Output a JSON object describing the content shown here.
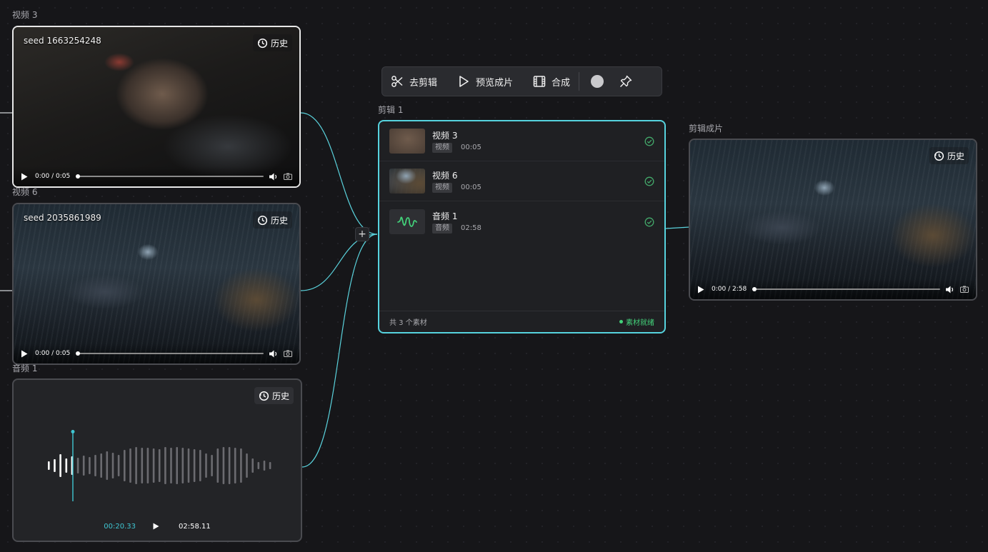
{
  "nodes": {
    "video3": {
      "label": "视频 3",
      "seed": "seed 1663254248",
      "history": "历史",
      "time": "0:00 / 0:05"
    },
    "video6": {
      "label": "视频 6",
      "seed": "seed 2035861989",
      "history": "历史",
      "time": "0:00 / 0:05"
    },
    "audio1": {
      "label": "音频 1",
      "history": "历史",
      "current_time": "00:20.33",
      "duration": "02:58.11",
      "playhead_fraction": 0.11
    },
    "final": {
      "label": "剪辑成片",
      "history": "历史",
      "time": "0:00 / 2:58"
    }
  },
  "toolbar": {
    "cut_label": "去剪辑",
    "preview_label": "预览成片",
    "compose_label": "合成"
  },
  "clip_panel": {
    "label": "剪辑 1",
    "items": [
      {
        "name": "视频 3",
        "type": "视频",
        "duration": "00:05"
      },
      {
        "name": "视频 6",
        "type": "视频",
        "duration": "00:05"
      },
      {
        "name": "音频 1",
        "type": "音频",
        "duration": "02:58"
      }
    ],
    "footer_count": "共 3 个素材",
    "footer_status": "素材就绪"
  },
  "colors": {
    "accent": "#56d3de",
    "ready": "#43d17a",
    "canvas": "#161619"
  },
  "icons": [
    "history-icon",
    "play-icon",
    "volume-icon",
    "camera-icon",
    "scissors-icon",
    "film-icon",
    "pin-icon",
    "check-circle-icon",
    "audio-wave-icon"
  ]
}
